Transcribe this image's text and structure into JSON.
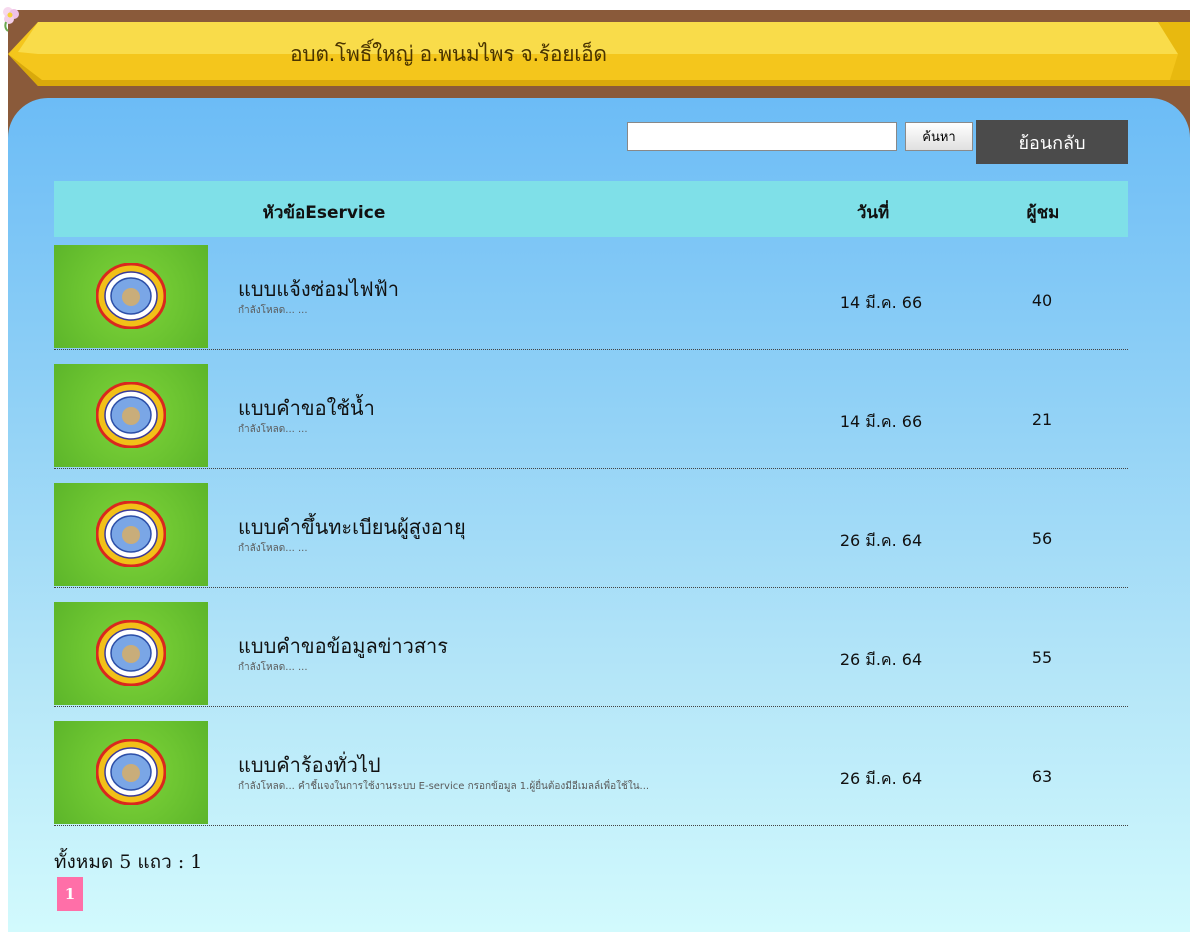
{
  "banner": {
    "title": "อบต.โพธิ์ใหญ่ อ.พนมไพร จ.ร้อยเอ็ด"
  },
  "search": {
    "value": "",
    "button_label": "ค้นหา"
  },
  "back_button": {
    "label": "ย้อนกลับ"
  },
  "table": {
    "columns": {
      "title": "หัวข้อEservice",
      "date": "วันที่",
      "views": "ผู้ชม"
    },
    "rows": [
      {
        "title": "แบบแจ้งซ่อมไฟฟ้า",
        "description": "กำลังโหลด... ...",
        "date": "14 มี.ค. 66",
        "views": "40"
      },
      {
        "title": "แบบคำขอใช้น้ำ",
        "description": "กำลังโหลด... ...",
        "date": "14 มี.ค. 66",
        "views": "21"
      },
      {
        "title": "แบบคำขึ้นทะเบียนผู้สูงอายุ",
        "description": "กำลังโหลด... ...",
        "date": "26 มี.ค. 64",
        "views": "56"
      },
      {
        "title": "แบบคำขอข้อมูลข่าวสาร",
        "description": "กำลังโหลด... ...",
        "date": "26 มี.ค. 64",
        "views": "55"
      },
      {
        "title": "แบบคำร้องทั่วไป",
        "description": "กำลังโหลด... คำชี้แจงในการใช้งานระบบ E-service กรอกข้อมูล 1.ผู้ยื่นต้องมีอีเมลล์เพื่อใช้ใน...",
        "date": "26 มี.ค. 64",
        "views": "63"
      }
    ]
  },
  "pagination": {
    "total_text": "ทั้งหมด 5 แถว : 1",
    "current_page": "1"
  },
  "colors": {
    "banner_yellow": "#f6c91e",
    "frame_brown": "#8a5a3a",
    "header_cyan": "#7fe0e8",
    "thumb_green": "#6cc431",
    "back_button_bg": "#4b4b4b",
    "page_link_pink": "#ff6fa8"
  }
}
